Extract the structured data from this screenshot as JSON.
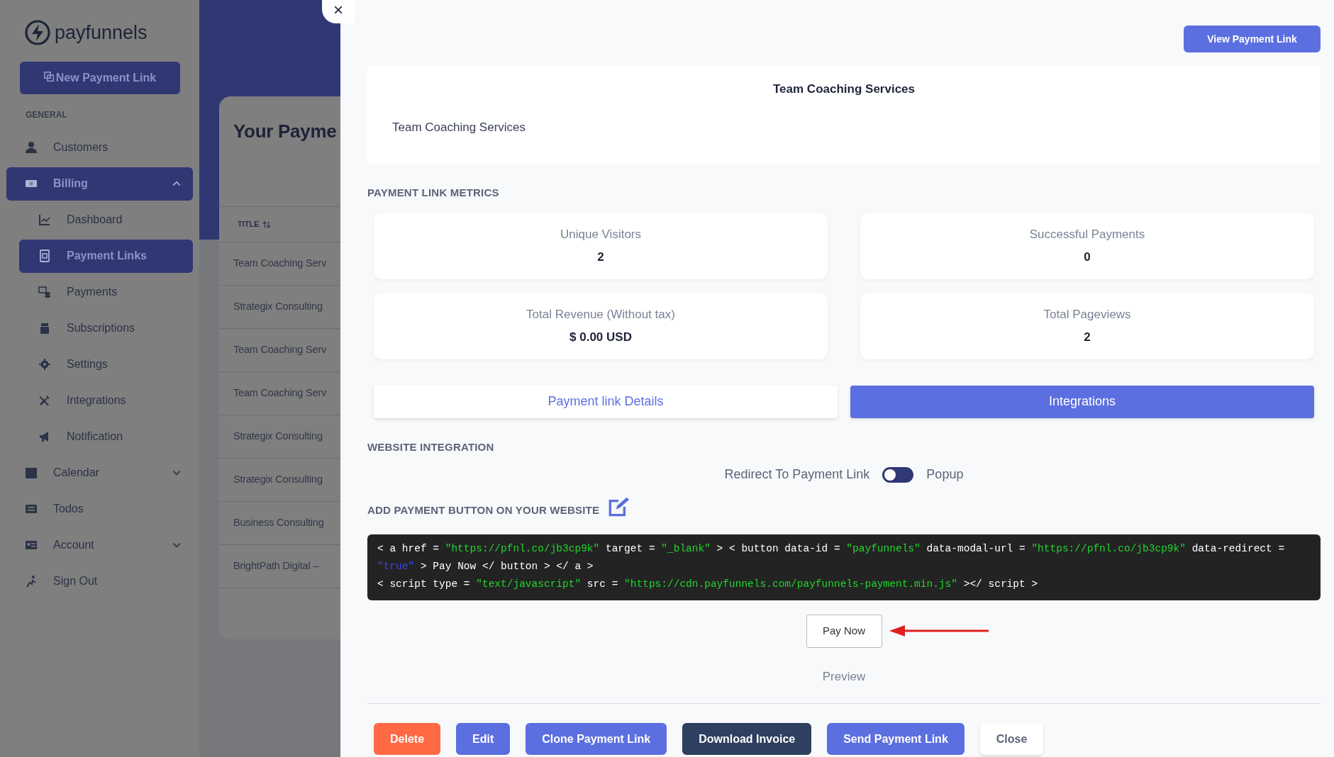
{
  "sidebar": {
    "brand": "payfunnels",
    "new_button": "New Payment Link",
    "section": "GENERAL",
    "items": [
      {
        "label": "Customers",
        "selected": false
      },
      {
        "label": "Billing",
        "selected": true,
        "expanded": true,
        "children": [
          {
            "label": "Dashboard",
            "selected": false
          },
          {
            "label": "Payment Links",
            "selected": true
          },
          {
            "label": "Payments",
            "selected": false
          },
          {
            "label": "Subscriptions",
            "selected": false
          },
          {
            "label": "Settings",
            "selected": false
          },
          {
            "label": "Integrations",
            "selected": false
          },
          {
            "label": "Notification",
            "selected": false
          }
        ]
      },
      {
        "label": "Calendar",
        "selected": false,
        "expanded": false
      },
      {
        "label": "Todos",
        "selected": false
      },
      {
        "label": "Account",
        "selected": false,
        "expanded": false
      },
      {
        "label": "Sign Out",
        "selected": false
      }
    ]
  },
  "background_page": {
    "title": "Your Payme",
    "column": "TITLE",
    "rows": [
      "Team Coaching Serv",
      "Strategix Consulting",
      "Team Coaching Serv",
      "Team Coaching Serv",
      "Strategix Consulting",
      "Strategix Consulting",
      "Business Consulting",
      "BrightPath Digital –"
    ]
  },
  "modal": {
    "close": "×",
    "view_button": "View Payment Link",
    "title": "Team Coaching Services",
    "description": "Team Coaching Services",
    "metrics_heading": "PAYMENT LINK METRICS",
    "metrics": [
      {
        "label": "Unique Visitors",
        "value": "2"
      },
      {
        "label": "Successful Payments",
        "value": "0"
      },
      {
        "label": "Total Revenue (Without tax)",
        "value": "$ 0.00 USD"
      },
      {
        "label": "Total Pageviews",
        "value": "2"
      }
    ],
    "tabs": [
      {
        "label": "Payment link Details",
        "selected": false
      },
      {
        "label": "Integrations",
        "selected": true
      }
    ],
    "integration_heading": "WEBSITE INTEGRATION",
    "toggle": {
      "left_label": "Redirect To Payment Link",
      "right_label": "Popup",
      "on": false
    },
    "button_heading": "ADD PAYMENT BUTTON ON YOUR WEBSITE",
    "code_lines": [
      [
        {
          "kind": "text",
          "text": "< a href = "
        },
        {
          "kind": "string",
          "text": "\"https://pfnl.co/jb3cp9k\""
        },
        {
          "kind": "text",
          "text": " target = "
        },
        {
          "kind": "string",
          "text": "\"_blank\""
        },
        {
          "kind": "text",
          "text": " > < button data-id = "
        },
        {
          "kind": "string",
          "text": "\"payfunnels\""
        },
        {
          "kind": "text",
          "text": " data-modal-url = "
        },
        {
          "kind": "string",
          "text": "\"https://pfnl.co/jb3cp9k\""
        },
        {
          "kind": "text",
          "text": " data-redirect = "
        },
        {
          "kind": "bool",
          "text": "\"true\""
        },
        {
          "kind": "text",
          "text": " > Pay Now </ button > </ a >"
        }
      ],
      [
        {
          "kind": "text",
          "text": "< script type = "
        },
        {
          "kind": "string",
          "text": "\"text/javascript\""
        },
        {
          "kind": "text",
          "text": " src = "
        },
        {
          "kind": "string",
          "text": "\"https://cdn.payfunnels.com/payfunnels-payment.min.js\""
        },
        {
          "kind": "text",
          "text": " ></ script >"
        }
      ]
    ],
    "preview_button": "Pay Now",
    "preview_label": "Preview",
    "actions": [
      {
        "label": "Delete",
        "kind": "danger"
      },
      {
        "label": "Edit",
        "kind": "primary"
      },
      {
        "label": "Clone Payment Link",
        "kind": "primary"
      },
      {
        "label": "Download Invoice",
        "kind": "dark"
      },
      {
        "label": "Send Payment Link",
        "kind": "primary"
      },
      {
        "label": "Close",
        "kind": "light"
      }
    ]
  }
}
